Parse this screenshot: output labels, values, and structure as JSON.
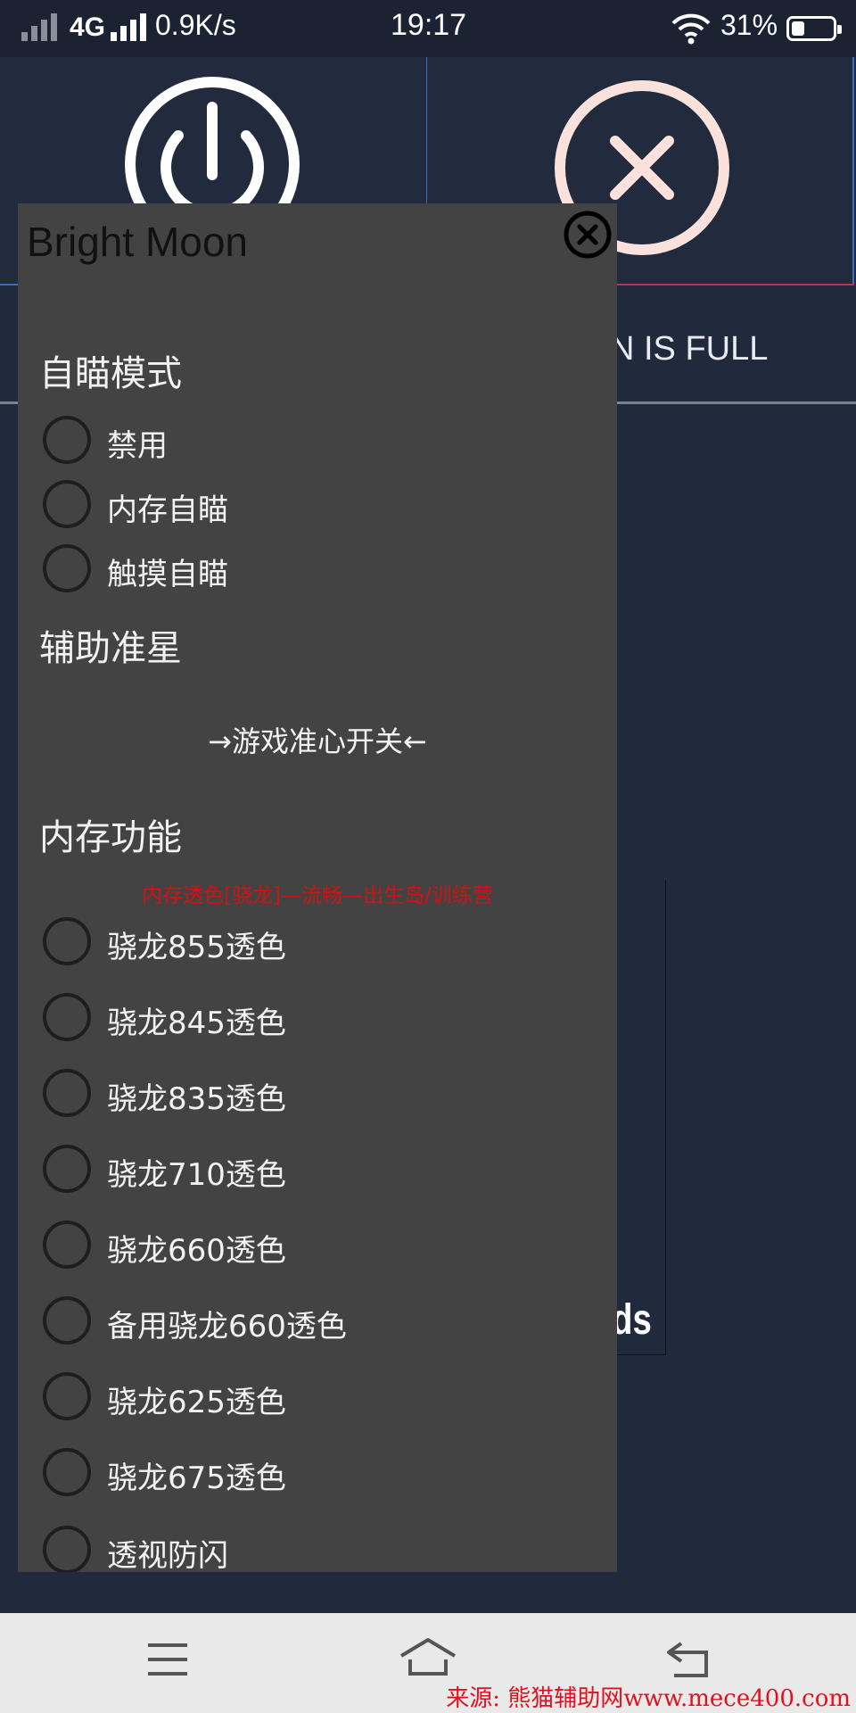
{
  "status_bar": {
    "network": "4G",
    "speed": "0.9K/s",
    "time": "19:17",
    "battery": "31%",
    "battery_level": 0.31
  },
  "background_app": {
    "full_text": "N IS FULL",
    "card_text": "ds"
  },
  "menu": {
    "title": "Bright Moon",
    "aim_section": "自瞄模式",
    "aim_options": [
      "禁用",
      "内存自瞄",
      "触摸自瞄"
    ],
    "crosshair_section": "辅助准星",
    "crosshair_toggle": "→游戏准心开关←",
    "memory_section": "内存功能",
    "memory_note": "内存透色[骁龙]—流畅—出生岛/训练营",
    "memory_options": [
      "骁龙855透色",
      "骁龙845透色",
      "骁龙835透色",
      "骁龙710透色",
      "骁龙660透色",
      "备用骁龙660透色",
      "骁龙625透色",
      "骁龙675透色",
      "透视防闪"
    ]
  },
  "watermark": "来源: 熊猫辅助网www.mece400.com",
  "colors": {
    "panel": "#434343",
    "background": "#202a3c",
    "note_red": "#d21212"
  }
}
